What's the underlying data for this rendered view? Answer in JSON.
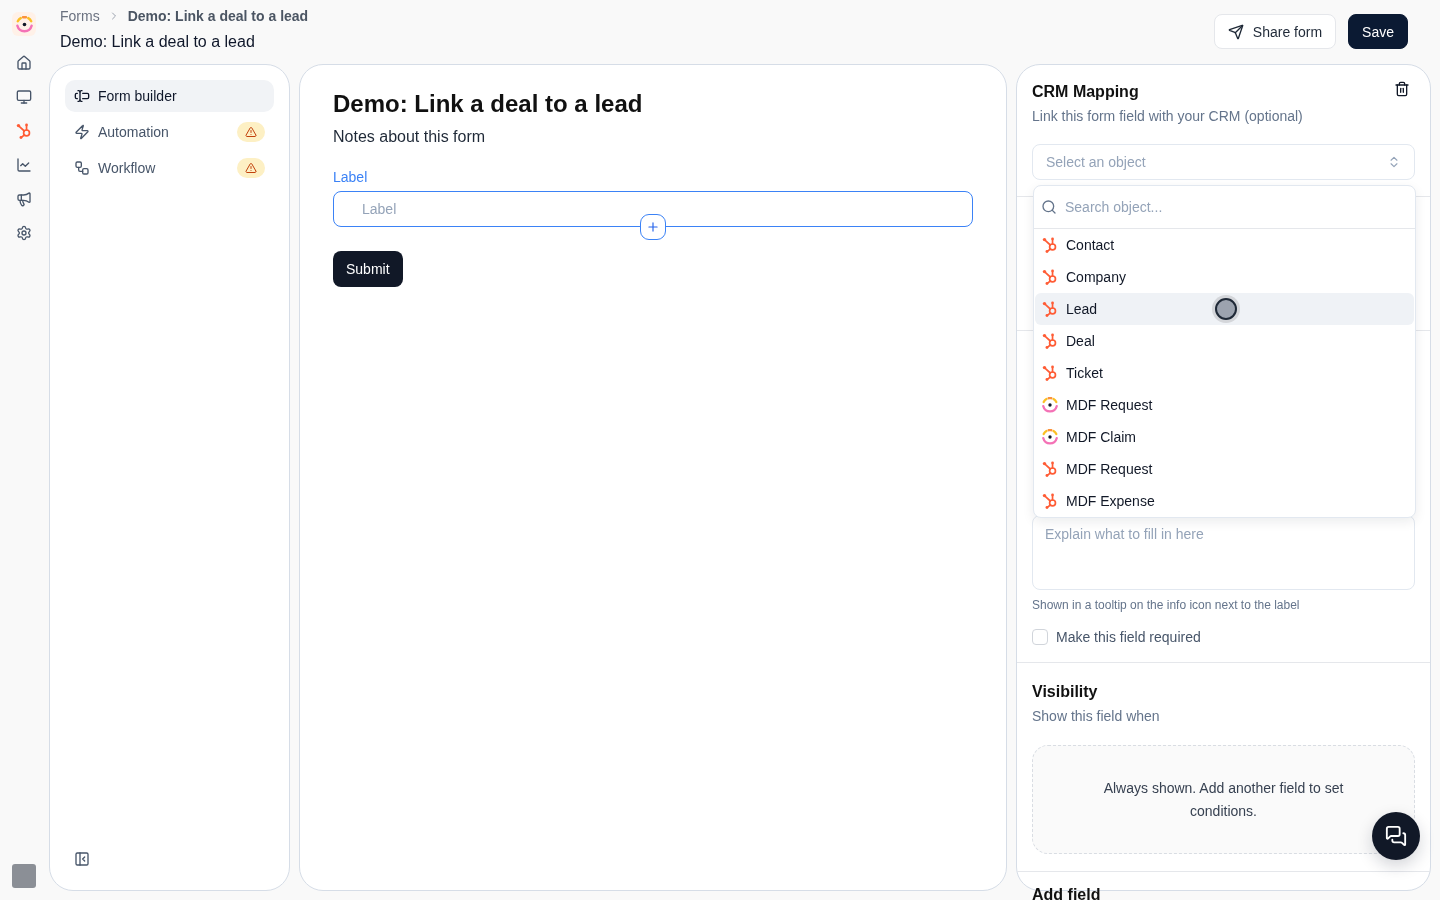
{
  "breadcrumb": [
    "Forms",
    "Demo: Link a deal to a lead"
  ],
  "page_title": "Demo: Link a deal to a lead",
  "actions": [
    {
      "label": "Share form",
      "kind": "secondary"
    },
    {
      "label": "Save",
      "kind": "primary"
    }
  ],
  "sidebar": {
    "items": [
      {
        "label": "Form builder",
        "selected": true,
        "warning": false
      },
      {
        "label": "Automation",
        "selected": false,
        "warning": true
      },
      {
        "label": "Workflow",
        "selected": false,
        "warning": true
      }
    ]
  },
  "form": {
    "title": "Demo: Link a deal to a lead",
    "description": "Notes about this form",
    "fields": [
      {
        "label": "Label",
        "placeholder": "Label",
        "focused": true
      }
    ],
    "submit": "Submit"
  },
  "crm_mapping": {
    "title": "CRM Mapping",
    "subtitle": "Link this form field with your CRM (optional)",
    "select": {
      "placeholder": "Select an object",
      "open": true,
      "search_placeholder": "Search object...",
      "options": [
        {
          "label": "Contact",
          "kind": "crm",
          "selected": false
        },
        {
          "label": "Company",
          "kind": "crm",
          "selected": false
        },
        {
          "label": "Lead",
          "kind": "crm",
          "selected": true
        },
        {
          "label": "Deal",
          "kind": "crm",
          "selected": false
        },
        {
          "label": "Ticket",
          "kind": "crm",
          "selected": false
        },
        {
          "label": "MDF Request",
          "kind": "app",
          "selected": false
        },
        {
          "label": "MDF Claim",
          "kind": "app",
          "selected": false
        },
        {
          "label": "MDF Request",
          "kind": "crm",
          "selected": false
        },
        {
          "label": "MDF Expense",
          "kind": "crm",
          "selected": false
        }
      ]
    }
  },
  "help_text": {
    "placeholder": "Explain what to fill in here",
    "hint": "Shown in a tooltip on the info icon next to the label"
  },
  "required": {
    "label": "Make this field required",
    "checked": false
  },
  "visibility": {
    "title": "Visibility",
    "subtitle": "Show this field when",
    "empty_message": "Always shown. Add another field to set conditions."
  },
  "next_section": {
    "title": "Add field"
  }
}
